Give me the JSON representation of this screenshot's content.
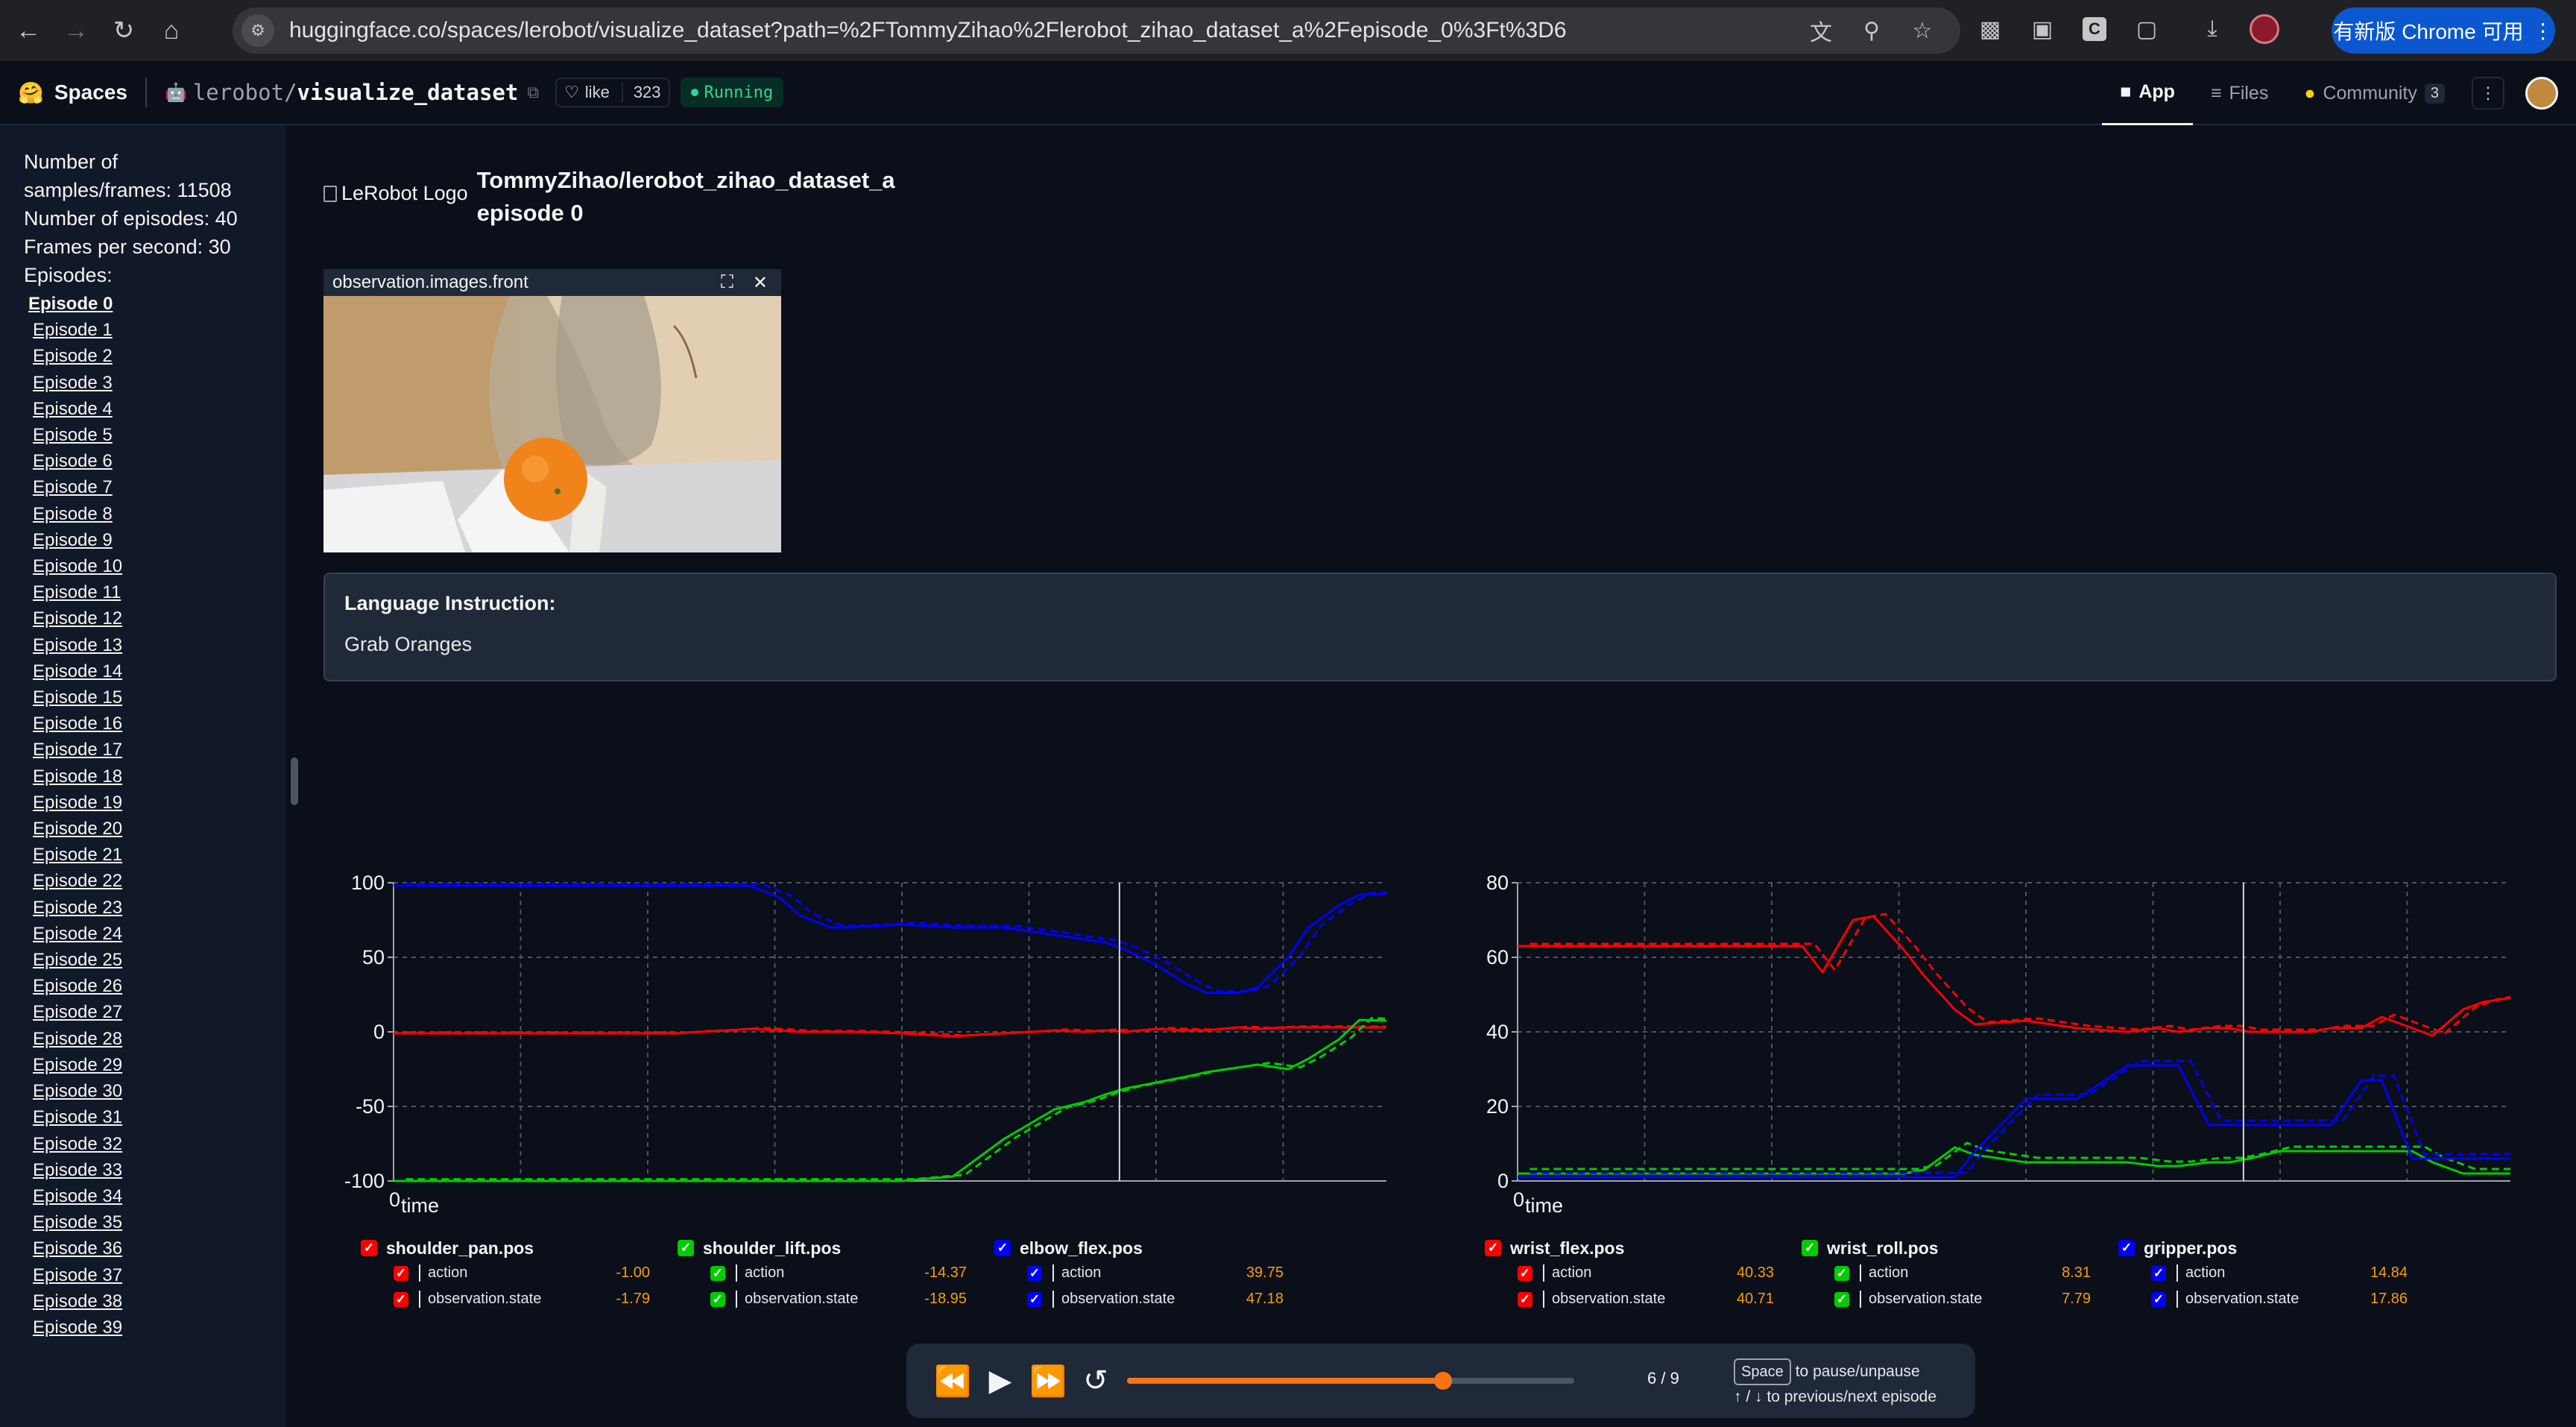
{
  "browser": {
    "url": "huggingface.co/spaces/lerobot/visualize_dataset?path=%2FTommyZihao%2Flerobot_zihao_dataset_a%2Fepisode_0%3Ft%3D6",
    "update_label": "有新版 Chrome 可用",
    "ext_c_label": "C"
  },
  "hf_header": {
    "spaces_label": "Spaces",
    "space_owner": "lerobot",
    "space_slash": "/",
    "space_name": "visualize_dataset",
    "like_label": "like",
    "like_count": "323",
    "status": "Running",
    "tabs": [
      {
        "label": "App",
        "active": true
      },
      {
        "label": "Files",
        "active": false
      },
      {
        "label": "Community",
        "count": "3",
        "active": false
      }
    ]
  },
  "sidebar": {
    "stats": [
      "Number of",
      "samples/frames: 11508",
      "Number of episodes: 40",
      "Frames per second: 30",
      "Episodes:"
    ],
    "episodes": [
      "Episode 0",
      "Episode 1",
      "Episode 2",
      "Episode 3",
      "Episode 4",
      "Episode 5",
      "Episode 6",
      "Episode 7",
      "Episode 8",
      "Episode 9",
      "Episode 10",
      "Episode 11",
      "Episode 12",
      "Episode 13",
      "Episode 14",
      "Episode 15",
      "Episode 16",
      "Episode 17",
      "Episode 18",
      "Episode 19",
      "Episode 20",
      "Episode 21",
      "Episode 22",
      "Episode 23",
      "Episode 24",
      "Episode 25",
      "Episode 26",
      "Episode 27",
      "Episode 28",
      "Episode 29",
      "Episode 30",
      "Episode 31",
      "Episode 32",
      "Episode 33",
      "Episode 34",
      "Episode 35",
      "Episode 36",
      "Episode 37",
      "Episode 38",
      "Episode 39"
    ],
    "current_episode": 0
  },
  "main": {
    "logo_alt": "LeRobot Logo",
    "repo_title": "TommyZihao/lerobot_zihao_dataset_a",
    "episode_title": "episode 0",
    "video_label": "observation.images.front",
    "language_label": "Language Instruction:",
    "language_text": "Grab Oranges"
  },
  "chart_data": [
    {
      "type": "line",
      "xlabel": "time",
      "x_tick": "0",
      "ylim": [
        -100,
        100
      ],
      "yticks": [
        "100",
        "50",
        "0",
        "-50",
        "-100"
      ],
      "grid": true,
      "cursor_x_fraction": 0.714,
      "x": [
        0,
        0.05,
        0.1,
        0.15,
        0.2,
        0.25,
        0.28,
        0.3,
        0.33,
        0.35,
        0.38,
        0.4,
        0.43,
        0.45,
        0.5,
        0.55,
        0.6,
        0.63,
        0.65,
        0.68,
        0.7,
        0.72,
        0.75,
        0.78,
        0.8,
        0.83,
        0.85,
        0.88,
        0.9,
        0.93,
        0.95,
        1.0
      ],
      "series": [
        {
          "name": "shoulder_pan.pos",
          "color": "#ff0000",
          "values": [
            -1,
            -1,
            -1,
            -1,
            -1,
            -1,
            -1,
            0,
            1,
            2,
            1,
            0,
            0,
            0,
            -1,
            -3,
            -1,
            0,
            1,
            0,
            1,
            0,
            2,
            1,
            1,
            3,
            2,
            3,
            3,
            3,
            3,
            3
          ]
        },
        {
          "name": "shoulder_lift.pos",
          "color": "#00cc00",
          "values": [
            -100,
            -100,
            -100,
            -100,
            -100,
            -100,
            -100,
            -100,
            -100,
            -100,
            -100,
            -100,
            -100,
            -100,
            -100,
            -97,
            -72,
            -60,
            -52,
            -47,
            -42,
            -38,
            -34,
            -30,
            -27,
            -24,
            -22,
            -25,
            -18,
            -5,
            8,
            7
          ]
        },
        {
          "name": "elbow_flex.pos",
          "color": "#0000ff",
          "values": [
            98,
            98,
            98,
            98,
            98,
            98,
            98,
            98,
            98,
            98,
            90,
            78,
            70,
            70,
            72,
            70,
            70,
            67,
            65,
            62,
            60,
            55,
            45,
            32,
            26,
            26,
            30,
            50,
            70,
            85,
            92,
            93
          ]
        }
      ]
    },
    {
      "type": "line",
      "xlabel": "time",
      "x_tick": "0",
      "ylim": [
        0,
        80
      ],
      "yticks": [
        "80",
        "60",
        "40",
        "20",
        "0"
      ],
      "grid": true,
      "cursor_x_fraction": 0.714,
      "x": [
        0,
        0.05,
        0.1,
        0.15,
        0.2,
        0.25,
        0.28,
        0.3,
        0.33,
        0.35,
        0.38,
        0.4,
        0.43,
        0.45,
        0.5,
        0.55,
        0.6,
        0.63,
        0.65,
        0.68,
        0.7,
        0.72,
        0.75,
        0.78,
        0.8,
        0.83,
        0.85,
        0.88,
        0.9,
        0.93,
        0.95,
        1.0
      ],
      "series": [
        {
          "name": "wrist_flex.pos",
          "color": "#ff0000",
          "values": [
            63,
            63,
            63,
            63,
            63,
            63,
            63,
            56,
            70,
            71,
            62,
            55,
            46,
            42,
            43,
            41,
            40,
            41,
            40,
            41,
            41,
            40,
            40,
            40,
            41,
            41,
            44,
            41,
            39,
            46,
            48,
            50
          ]
        },
        {
          "name": "wrist_roll.pos",
          "color": "#00cc00",
          "values": [
            2,
            2,
            2,
            2,
            2,
            2,
            2,
            2,
            2,
            2,
            2,
            3,
            9,
            7,
            5,
            5,
            5,
            4,
            4,
            5,
            5,
            6,
            8,
            8,
            8,
            8,
            8,
            8,
            5,
            2,
            2,
            2
          ]
        },
        {
          "name": "gripper.pos",
          "color": "#0000ff",
          "values": [
            1,
            1,
            1,
            1,
            1,
            1,
            1,
            1,
            1,
            1,
            1,
            1,
            1,
            8,
            22,
            22,
            31,
            31,
            31,
            15,
            15,
            15,
            15,
            15,
            15,
            27,
            27,
            6,
            6,
            6,
            6,
            6
          ]
        }
      ]
    }
  ],
  "legend": {
    "left": [
      {
        "name": "shoulder_pan.pos",
        "color": "#ff0000",
        "rows": [
          {
            "label": "action",
            "value": "-1.00"
          },
          {
            "label": "observation.state",
            "value": "-1.79"
          }
        ]
      },
      {
        "name": "shoulder_lift.pos",
        "color": "#00cc00",
        "rows": [
          {
            "label": "action",
            "value": "-14.37"
          },
          {
            "label": "observation.state",
            "value": "-18.95"
          }
        ]
      },
      {
        "name": "elbow_flex.pos",
        "color": "#0000ff",
        "rows": [
          {
            "label": "action",
            "value": "39.75"
          },
          {
            "label": "observation.state",
            "value": "47.18"
          }
        ]
      }
    ],
    "right": [
      {
        "name": "wrist_flex.pos",
        "color": "#ff0000",
        "rows": [
          {
            "label": "action",
            "value": "40.33"
          },
          {
            "label": "observation.state",
            "value": "40.71"
          }
        ]
      },
      {
        "name": "wrist_roll.pos",
        "color": "#00cc00",
        "rows": [
          {
            "label": "action",
            "value": "8.31"
          },
          {
            "label": "observation.state",
            "value": "7.79"
          }
        ]
      },
      {
        "name": "gripper.pos",
        "color": "#0000ff",
        "rows": [
          {
            "label": "action",
            "value": "14.84"
          },
          {
            "label": "observation.state",
            "value": "17.86"
          }
        ]
      }
    ]
  },
  "playback": {
    "progress": 0.706,
    "counter": "6 / 9",
    "hint_space_key": "Space",
    "hint_space": "to pause/unpause",
    "hint_arrows": "↑ / ↓",
    "hint_episode": "to previous/next episode"
  }
}
